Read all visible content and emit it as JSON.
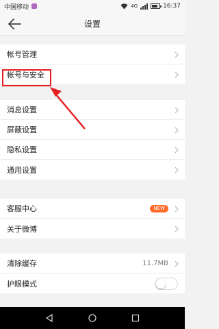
{
  "status_bar": {
    "carrier": "中国移动",
    "network": "4G",
    "time": "16:37"
  },
  "header": {
    "title": "设置",
    "back_icon": "arrow-left-icon"
  },
  "groups": [
    {
      "items": [
        {
          "label": "帐号管理"
        },
        {
          "label": "帐号与安全"
        }
      ]
    },
    {
      "items": [
        {
          "label": "消息设置"
        },
        {
          "label": "屏蔽设置"
        },
        {
          "label": "隐私设置"
        },
        {
          "label": "通用设置"
        }
      ]
    },
    {
      "items": [
        {
          "label": "客服中心",
          "badge": "NEW"
        },
        {
          "label": "关于微博"
        }
      ]
    },
    {
      "items": [
        {
          "label": "清除缓存",
          "value": "11.7MB"
        },
        {
          "label": "护眼模式",
          "toggle_on": false
        }
      ]
    }
  ],
  "colors": {
    "highlight": "#e41e1e",
    "badge": "#ff6a2a"
  }
}
